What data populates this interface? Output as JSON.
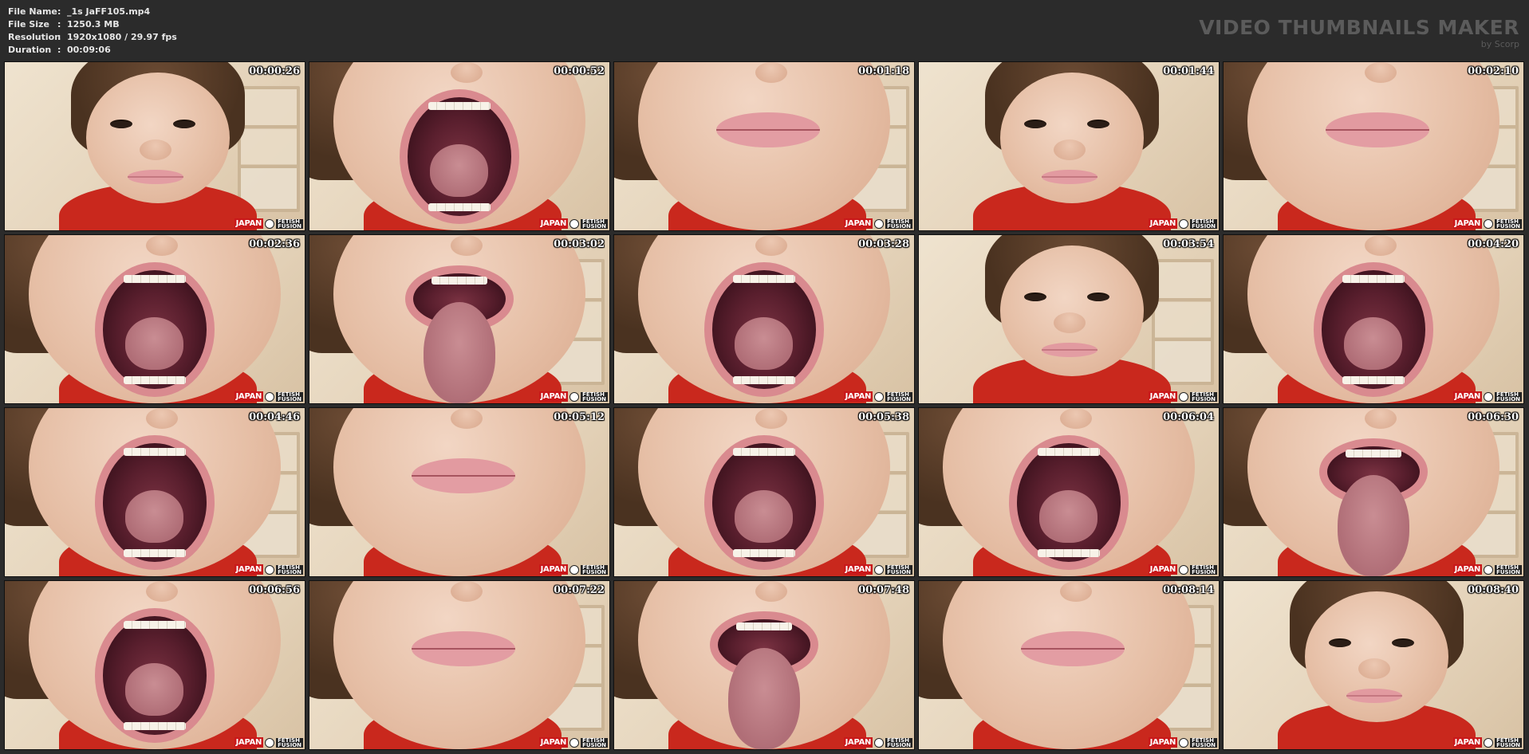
{
  "file_info": {
    "rows": [
      {
        "label": "File Name",
        "sep": ":",
        "value": "_1s JaFF105.mp4"
      },
      {
        "label": "File Size",
        "sep": ":",
        "value": "1250.3 MB"
      },
      {
        "label": "Resolution",
        "sep": ":",
        "value": "1920x1080 / 29.97 fps"
      },
      {
        "label": "Duration",
        "sep": ":",
        "value": "00:09:06"
      }
    ]
  },
  "brand": {
    "title": "VIDEO THUMBNAILS MAKER",
    "subtitle": "by Scorp"
  },
  "watermark": {
    "left": "JAPAN",
    "right_top": "FETISH",
    "right_bottom": "FUSION"
  },
  "thumbnails": [
    {
      "timestamp": "00:00:26",
      "scene": "face-smile"
    },
    {
      "timestamp": "00:00:52",
      "scene": "mouth-open"
    },
    {
      "timestamp": "00:01:18",
      "scene": "lips-closed"
    },
    {
      "timestamp": "00:01:44",
      "scene": "face-smile"
    },
    {
      "timestamp": "00:02:10",
      "scene": "lips-closed"
    },
    {
      "timestamp": "00:02:36",
      "scene": "mouth-open"
    },
    {
      "timestamp": "00:03:02",
      "scene": "tongue-out"
    },
    {
      "timestamp": "00:03:28",
      "scene": "mouth-open"
    },
    {
      "timestamp": "00:03:54",
      "scene": "face-close"
    },
    {
      "timestamp": "00:04:20",
      "scene": "mouth-open"
    },
    {
      "timestamp": "00:04:46",
      "scene": "mouth-open"
    },
    {
      "timestamp": "00:05:12",
      "scene": "lips-closed"
    },
    {
      "timestamp": "00:05:38",
      "scene": "mouth-open"
    },
    {
      "timestamp": "00:06:04",
      "scene": "mouth-open"
    },
    {
      "timestamp": "00:06:30",
      "scene": "tongue-out"
    },
    {
      "timestamp": "00:06:56",
      "scene": "mouth-open"
    },
    {
      "timestamp": "00:07:22",
      "scene": "lips-closed"
    },
    {
      "timestamp": "00:07:48",
      "scene": "tongue-out"
    },
    {
      "timestamp": "00:08:14",
      "scene": "lips-closed"
    },
    {
      "timestamp": "00:08:40",
      "scene": "face-smile"
    }
  ]
}
